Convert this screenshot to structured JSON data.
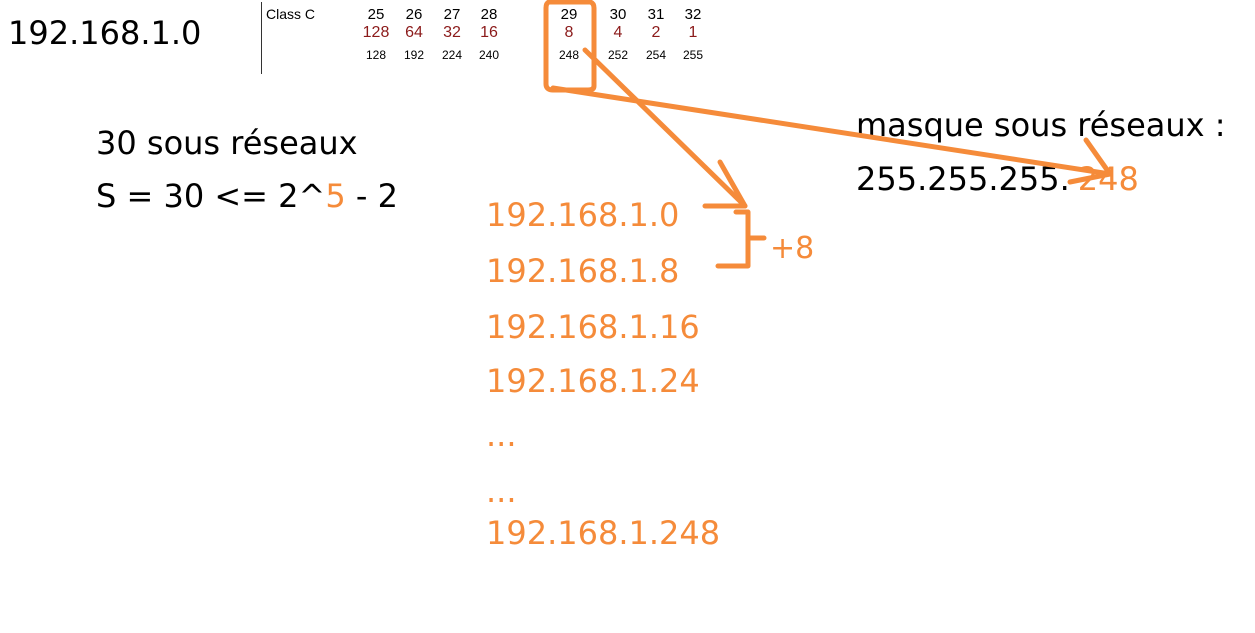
{
  "network": "192.168.1.0",
  "table": {
    "label": "Class C",
    "bits": [
      "25",
      "26",
      "27",
      "28",
      "29",
      "30",
      "31",
      "32"
    ],
    "values": [
      "128",
      "64",
      "32",
      "16",
      "8",
      "4",
      "2",
      "1"
    ],
    "masks": [
      "128",
      "192",
      "224",
      "240",
      "248",
      "252",
      "254",
      "255"
    ]
  },
  "left": {
    "line1": "30 sous réseaux",
    "line2_prefix": "S = 30 <= 2^",
    "line2_exp": "5",
    "line2_suffix": " - 2"
  },
  "mask": {
    "label": "masque sous réseaux :",
    "prefix": "255.255.255.",
    "value": "248"
  },
  "subnets": [
    "192.168.1.0",
    "192.168.1.8",
    "192.168.1.16",
    "192.168.1.24",
    "...",
    "...",
    "192.168.1.248"
  ],
  "step_label": "+8",
  "colors": {
    "accent": "#f58b3a",
    "table_values": "#8b1a1a"
  }
}
